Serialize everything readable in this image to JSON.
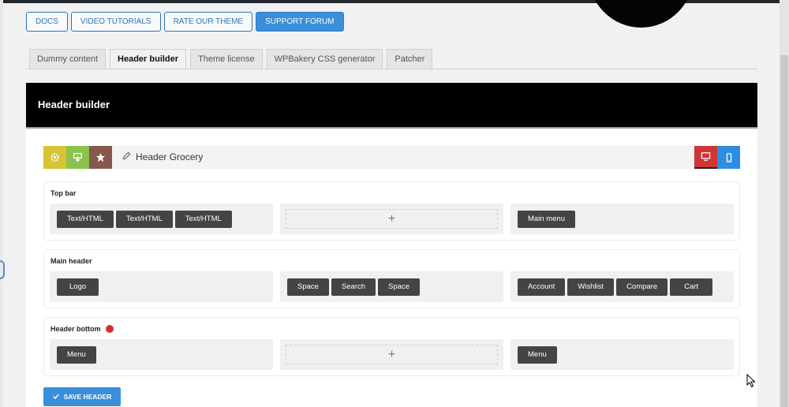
{
  "top_buttons": [
    {
      "label": "DOCS"
    },
    {
      "label": "VIDEO TUTORIALS"
    },
    {
      "label": "RATE OUR THEME"
    },
    {
      "label": "SUPPORT FORUM"
    }
  ],
  "tabs": [
    {
      "label": "Dummy content"
    },
    {
      "label": "Header builder"
    },
    {
      "label": "Theme license"
    },
    {
      "label": "WPBakery CSS generator"
    },
    {
      "label": "Patcher"
    }
  ],
  "panel": {
    "title": "Header builder"
  },
  "toolbar": {
    "icons": [
      "gear-icon",
      "download-icon",
      "star-icon"
    ],
    "header_name": "Header Grocery",
    "edit_icon": "pencil-icon",
    "devices": [
      "desktop-icon",
      "mobile-icon"
    ]
  },
  "sections": {
    "top_bar": {
      "title": "Top bar",
      "left": [
        "Text/HTML",
        "Text/HTML",
        "Text/HTML"
      ],
      "center_add": "+",
      "right": [
        "Main menu"
      ]
    },
    "main_header": {
      "title": "Main header",
      "left": [
        "Logo"
      ],
      "center": [
        "Space",
        "Search",
        "Space"
      ],
      "right": [
        "Account",
        "Wishlist",
        "Compare",
        "Cart"
      ]
    },
    "header_bottom": {
      "title": "Header bottom",
      "left": [
        "Menu"
      ],
      "center_add": "+",
      "right": [
        "Menu"
      ]
    }
  },
  "save": {
    "label": "SAVE HEADER"
  },
  "colors": {
    "primary": "#3b8fd9",
    "element": "#444444",
    "alert": "#d32f2f"
  }
}
